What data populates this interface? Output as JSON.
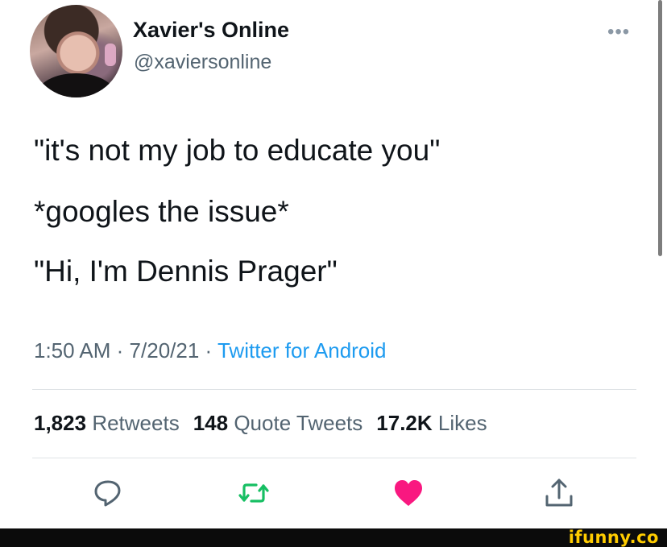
{
  "author": {
    "name": "Xavier's Online",
    "handle": "@xaviersonline"
  },
  "menu": {
    "more_label": "•••"
  },
  "tweet": {
    "lines": [
      "\"it's not my job to educate you\"",
      "*googles the issue*",
      "\"Hi, I'm Dennis Prager\""
    ],
    "time": "1:50 AM",
    "date": "7/20/21",
    "source": "Twitter for Android",
    "separator": "·"
  },
  "stats": {
    "retweets": {
      "count": "1,823",
      "label": "Retweets"
    },
    "quotes": {
      "count": "148",
      "label": "Quote Tweets"
    },
    "likes": {
      "count": "17.2K",
      "label": "Likes"
    }
  },
  "actions": [
    {
      "icon": "reply-icon"
    },
    {
      "icon": "retweet-icon",
      "color": "#17bf63"
    },
    {
      "icon": "like-icon",
      "color": "#f91880",
      "state": "liked"
    },
    {
      "icon": "share-icon"
    }
  ],
  "watermark": {
    "text": "ifunny.co"
  },
  "colors": {
    "primary_text": "#0f1419",
    "secondary_text": "#536471",
    "link": "#1d9bf0",
    "retweet_green": "#17bf63",
    "like_pink": "#f91880",
    "watermark_yellow": "#ffcc00"
  }
}
